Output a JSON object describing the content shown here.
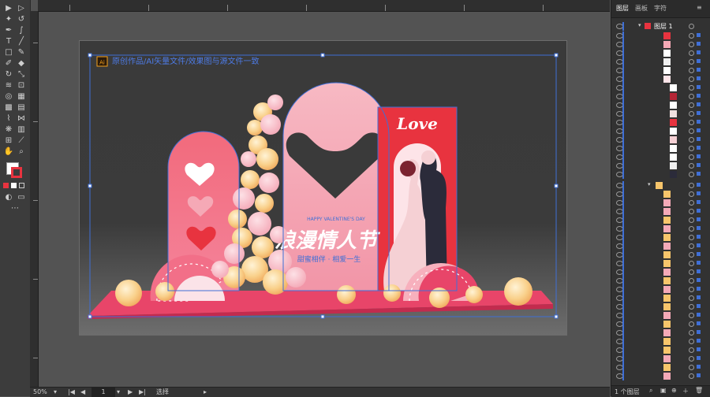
{
  "app": {
    "name": "Adobe Illustrator"
  },
  "artboard": {
    "notice_badge": "Ai",
    "notice_text": "原创作品/AI矢量文件/效果图与源文件一致",
    "love_text": "Love",
    "title_small": "HAPPY VALENTINE'S DAY",
    "title_main": "浪漫情人节",
    "subtitle": "甜蜜相伴 · 相爱一生"
  },
  "status": {
    "zoom": "50%",
    "page": "1",
    "tool_name": "选择"
  },
  "panel": {
    "tabs": [
      "图层",
      "画板",
      "字符"
    ],
    "active_tab": "图层",
    "layer_name": "图层 1",
    "footer_count": "1 个图层"
  },
  "colors": {
    "pink": "#f2a7b4",
    "red": "#e8333f",
    "coral": "#f0546a",
    "gold": "#f7c56b",
    "selection": "#3f6fd6"
  }
}
